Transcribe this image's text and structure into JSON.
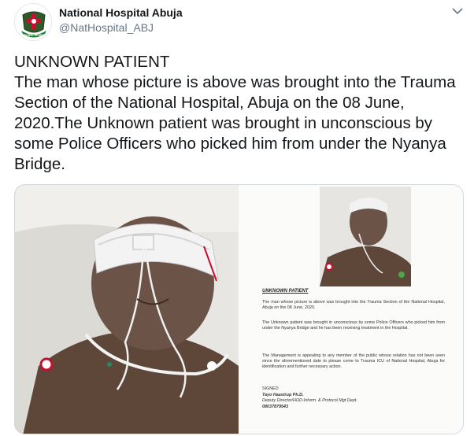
{
  "account": {
    "name": "National Hospital Abuja",
    "handle": "@NatHospital_ABJ",
    "avatar_icon": "hospital-crest-icon",
    "avatar_text": "NATIONAL HOSPITAL"
  },
  "tweet": {
    "text": "UNKNOWN PATIENT\nThe man whose picture is above was brought into the Trauma Section of the National Hospital, Abuja on the 08 June, 2020.The Unknown patient was brought in unconscious by some Police Officers who picked him from under the Nyanya Bridge."
  },
  "menu": {
    "icon": "chevron-down-icon"
  },
  "media": {
    "notice": {
      "title": "UNKNOWN PATIENT",
      "p1": "The man whose picture is above was brought into the Trauma Section of the National Hospital, Abuja on the 08 June, 2020.",
      "p2": "The Unknown patient was brought in unconscious by some Police Officers who picked him from under the Nyanya Bridge and he has been receiving treatment in the Hospital.",
      "p3": "The Management is appealing to any member of the public whose relation has not been seen since the aforementioned date to please come to Trauma ICU of National Hospital, Abuja for identification and further necessary action.",
      "signed": "SIGNED",
      "signer": "Tayo Haastrup Ph.D.",
      "role": "Deputy Director/HOD-Inform. & Protocol Mgt Dept.",
      "phone": "08037879543"
    }
  },
  "colors": {
    "text": "#14171a",
    "secondary": "#657786",
    "border": "#cfd9de",
    "skin": "#6b5347"
  }
}
